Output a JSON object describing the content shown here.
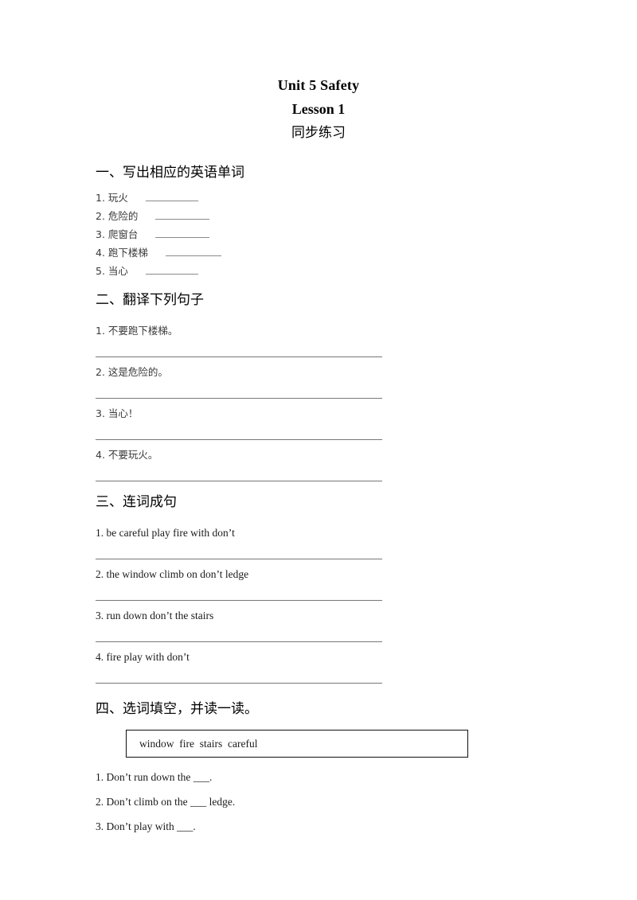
{
  "document": {
    "title": "Unit 5 Safety",
    "subtitle": "Lesson 1",
    "subsubtitle": "同步练习"
  },
  "sections": [
    {
      "heading": "一、写出相应的英语单词",
      "items": [
        {
          "label": "1. 玩火"
        },
        {
          "label": "2. 危险的"
        },
        {
          "label": "3. 爬窗台"
        },
        {
          "label": "4. 跑下楼梯"
        },
        {
          "label": "5. 当心"
        }
      ]
    },
    {
      "heading": "二、翻译下列句子",
      "items": [
        {
          "label": "1. 不要跑下楼梯。"
        },
        {
          "label": "2. 这是危险的。"
        },
        {
          "label": "3. 当心！"
        },
        {
          "label": "4. 不要玩火。"
        }
      ]
    },
    {
      "heading": "三、连词成句",
      "items": [
        {
          "label": "1. be careful play fire with don’t"
        },
        {
          "label": "2. the window climb on don’t ledge"
        },
        {
          "label": "3. run down don’t the stairs"
        },
        {
          "label": "4. fire play with don’t"
        }
      ]
    },
    {
      "heading": "四、选词填空，并读一读。",
      "wordbank": "window  fire  stairs  careful",
      "items": [
        {
          "label": "1. Don’t run down the ___."
        },
        {
          "label": "2. Don’t climb on the ___ ledge."
        },
        {
          "label": "3. Don’t play with ___."
        }
      ]
    }
  ]
}
